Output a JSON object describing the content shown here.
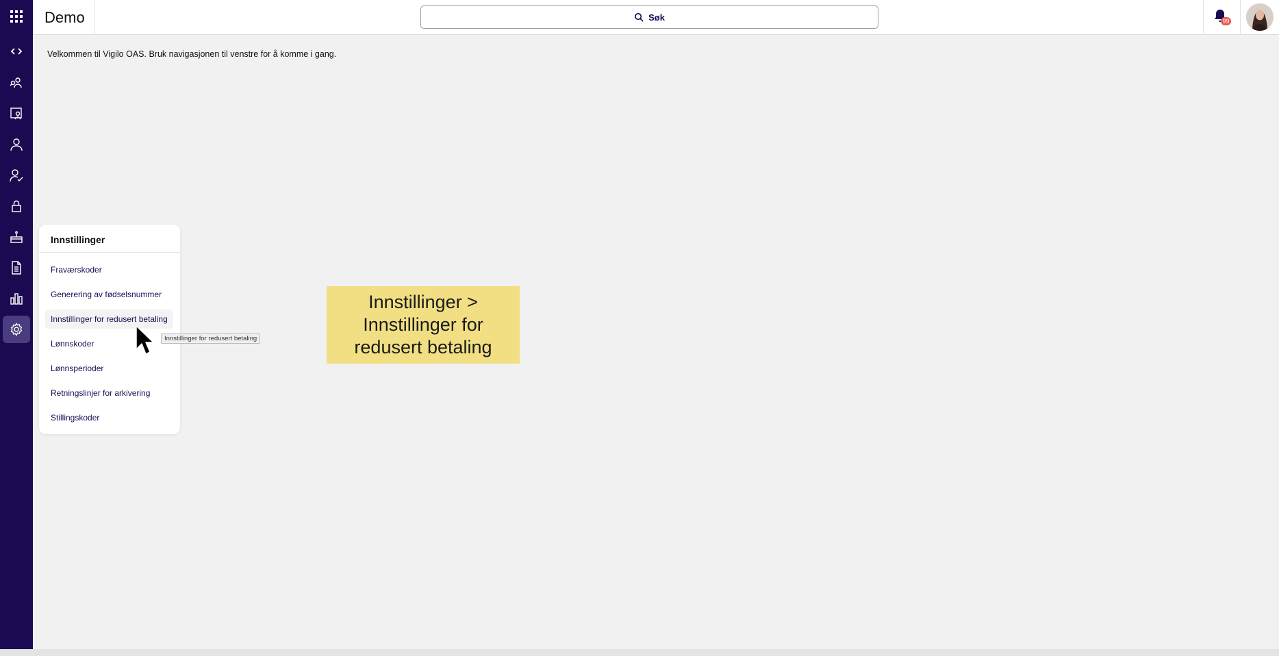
{
  "header": {
    "brand": "Demo",
    "search_label": "Søk",
    "notification_count": "99"
  },
  "rail": {
    "items": [
      {
        "name": "apps-grid-icon"
      },
      {
        "name": "code-icon"
      },
      {
        "name": "people-search-icon"
      },
      {
        "name": "screen-user-icon"
      },
      {
        "name": "user-icon"
      },
      {
        "name": "user-check-icon"
      },
      {
        "name": "lock-icon"
      },
      {
        "name": "cake-icon"
      },
      {
        "name": "document-icon"
      },
      {
        "name": "bar-chart-icon"
      },
      {
        "name": "gear-icon",
        "active": true
      }
    ]
  },
  "main": {
    "welcome_text": "Velkommen til Vigilo OAS. Bruk navigasjonen til venstre for å komme i gang."
  },
  "flyout": {
    "title": "Innstillinger",
    "items": [
      "Fraværskoder",
      "Generering av fødselsnummer",
      "Innstillinger for redusert betaling",
      "Lønnskoder",
      "Lønnsperioder",
      "Retningslinjer for arkivering",
      "Stillingskoder"
    ]
  },
  "tooltip": "Innstillinger for redusert betaling",
  "callout": "Innstillinger > Innstillinger for redusert betaling",
  "colors": {
    "rail": "#1b0a52",
    "rail_active": "#4a3c7e",
    "accent_text": "#1b0a52",
    "callout_bg": "#f2df84",
    "badge": "#e8594f"
  }
}
